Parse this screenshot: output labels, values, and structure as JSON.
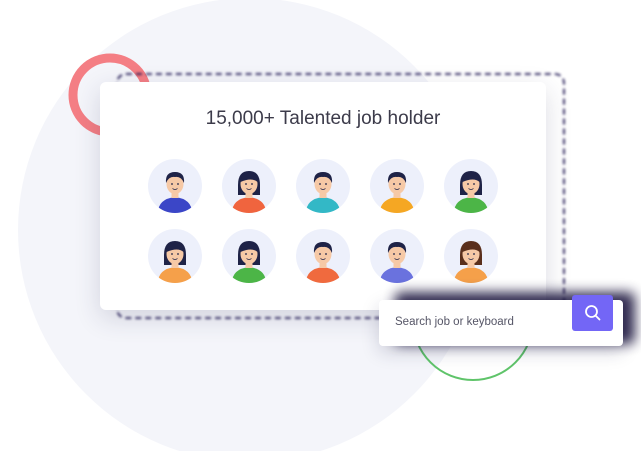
{
  "heading": "15,000+ Talented job holder",
  "search": {
    "placeholder": "Search job or keyboard",
    "button_icon": "search-icon"
  },
  "colors": {
    "accent": "#7366f6",
    "ring_pink": "#f47e84",
    "ring_green": "#5fc46a",
    "blob": "#f4f5fa"
  },
  "avatars": [
    {
      "skin": "#f6c9a6",
      "hair": "#1f2347",
      "shirt": "#3b46c7",
      "style": "m"
    },
    {
      "skin": "#f6c9a6",
      "hair": "#1f2347",
      "shirt": "#f0643e",
      "style": "f"
    },
    {
      "skin": "#f6c9a6",
      "hair": "#1f2347",
      "shirt": "#33b8c6",
      "style": "m"
    },
    {
      "skin": "#f6c9a6",
      "hair": "#1f2347",
      "shirt": "#f5a723",
      "style": "m"
    },
    {
      "skin": "#f6c9a6",
      "hair": "#1f2347",
      "shirt": "#4cb547",
      "style": "f"
    },
    {
      "skin": "#f6c9a6",
      "hair": "#1f2347",
      "shirt": "#f5a04a",
      "style": "f"
    },
    {
      "skin": "#f6c9a6",
      "hair": "#1f2347",
      "shirt": "#4cb547",
      "style": "f"
    },
    {
      "skin": "#f6c9a6",
      "hair": "#1f2347",
      "shirt": "#f06a3e",
      "style": "m"
    },
    {
      "skin": "#f6c9a6",
      "hair": "#1f2347",
      "shirt": "#6a72de",
      "style": "m"
    },
    {
      "skin": "#f6c9a6",
      "hair": "#5a2f1c",
      "shirt": "#f5a04a",
      "style": "f"
    }
  ]
}
